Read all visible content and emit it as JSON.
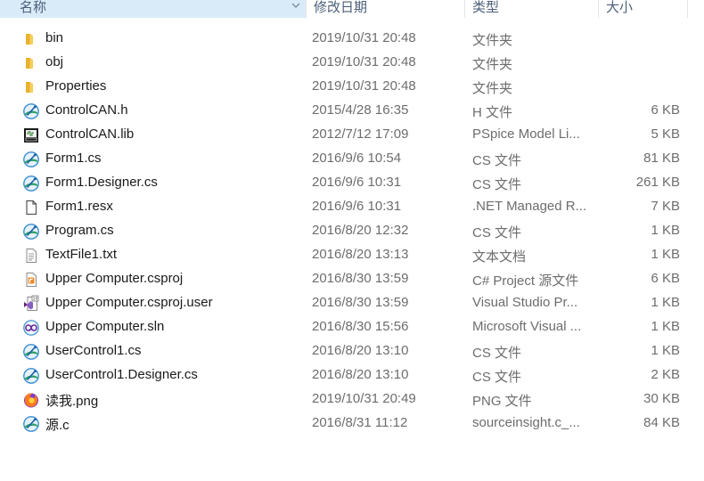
{
  "columns": {
    "name": "名称",
    "date": "修改日期",
    "type": "类型",
    "size": "大小"
  },
  "files": [
    {
      "name": "bin",
      "date": "2019/10/31 20:48",
      "type": "文件夹",
      "size": "",
      "icon": "folder-icon"
    },
    {
      "name": "obj",
      "date": "2019/10/31 20:48",
      "type": "文件夹",
      "size": "",
      "icon": "folder-icon"
    },
    {
      "name": "Properties",
      "date": "2019/10/31 20:48",
      "type": "文件夹",
      "size": "",
      "icon": "folder-icon"
    },
    {
      "name": "ControlCAN.h",
      "date": "2015/4/28 16:35",
      "type": "H 文件",
      "size": "6 KB",
      "icon": "sourceinsight-file-icon"
    },
    {
      "name": "ControlCAN.lib",
      "date": "2012/7/12 17:09",
      "type": "PSpice Model Li...",
      "size": "5 KB",
      "icon": "pspice-model-icon"
    },
    {
      "name": "Form1.cs",
      "date": "2016/9/6 10:54",
      "type": "CS 文件",
      "size": "81 KB",
      "icon": "sourceinsight-file-icon"
    },
    {
      "name": "Form1.Designer.cs",
      "date": "2016/9/6 10:31",
      "type": "CS 文件",
      "size": "261 KB",
      "icon": "sourceinsight-file-icon"
    },
    {
      "name": "Form1.resx",
      "date": "2016/9/6 10:31",
      "type": ".NET Managed R...",
      "size": "7 KB",
      "icon": "resx-file-icon"
    },
    {
      "name": "Program.cs",
      "date": "2016/8/20 12:32",
      "type": "CS 文件",
      "size": "1 KB",
      "icon": "sourceinsight-file-icon"
    },
    {
      "name": "TextFile1.txt",
      "date": "2016/8/20 13:13",
      "type": "文本文档",
      "size": "1 KB",
      "icon": "text-file-icon"
    },
    {
      "name": "Upper Computer.csproj",
      "date": "2016/8/30 13:59",
      "type": "C# Project 源文件",
      "size": "6 KB",
      "icon": "csproj-file-icon"
    },
    {
      "name": "Upper Computer.csproj.user",
      "date": "2016/8/30 13:59",
      "type": "Visual Studio Pr...",
      "size": "1 KB",
      "icon": "visual-studio-icon"
    },
    {
      "name": "Upper Computer.sln",
      "date": "2016/8/30 15:56",
      "type": "Microsoft Visual ...",
      "size": "1 KB",
      "icon": "solution-file-icon"
    },
    {
      "name": "UserControl1.cs",
      "date": "2016/8/20 13:10",
      "type": "CS 文件",
      "size": "1 KB",
      "icon": "sourceinsight-file-icon"
    },
    {
      "name": "UserControl1.Designer.cs",
      "date": "2016/8/20 13:10",
      "type": "CS 文件",
      "size": "2 KB",
      "icon": "sourceinsight-file-icon"
    },
    {
      "name": "读我.png",
      "date": "2019/10/31 20:49",
      "type": "PNG 文件",
      "size": "30 KB",
      "icon": "firefox-image-icon"
    },
    {
      "name": "源.c",
      "date": "2016/8/31 11:12",
      "type": "sourceinsight.c_...",
      "size": "84 KB",
      "icon": "sourceinsight-file-icon"
    }
  ],
  "colors": {
    "header_selected_bg": "#d9ebf9",
    "folder": "#f0c24a",
    "secondary_text": "#6d6d6d"
  }
}
